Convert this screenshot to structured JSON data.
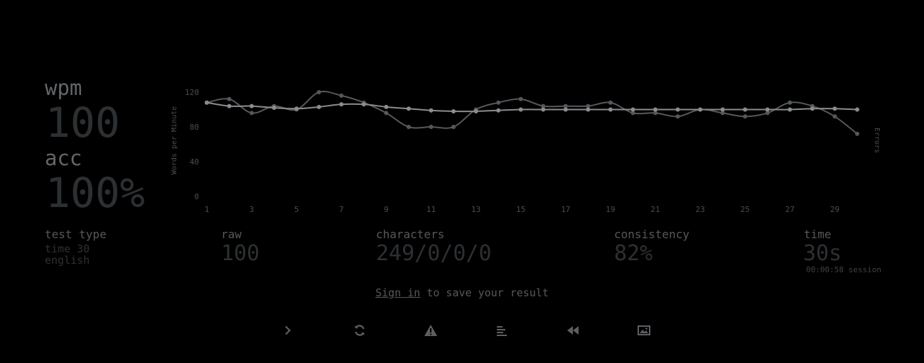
{
  "stats": {
    "wpm_label": "wpm",
    "wpm_value": "100",
    "acc_label": "acc",
    "acc_value": "100%"
  },
  "details": {
    "test_type_label": "test type",
    "test_type_mode": "time 30",
    "test_type_language": "english",
    "raw_label": "raw",
    "raw_value": "100",
    "characters_label": "characters",
    "characters_value": "249/0/0/0",
    "consistency_label": "consistency",
    "consistency_value": "82%",
    "time_label": "time",
    "time_value": "30s",
    "session_text": "00:00:58 session"
  },
  "signin": {
    "link_text": "Sign in",
    "rest_text": " to save your result"
  },
  "buttons": [
    {
      "name": "next-test-button",
      "icon": "chevron-right-icon"
    },
    {
      "name": "restart-button",
      "icon": "refresh-icon"
    },
    {
      "name": "report-button",
      "icon": "warning-icon"
    },
    {
      "name": "words-history-button",
      "icon": "align-left-icon"
    },
    {
      "name": "replay-button",
      "icon": "rewind-icon"
    },
    {
      "name": "screenshot-button",
      "icon": "image-icon"
    }
  ],
  "colors": {
    "background": "#000000",
    "wpm_line": "#8a8d90",
    "raw_line": "#55585b",
    "text_main": "#636669",
    "text_dim": "#2d3033"
  },
  "chart_data": {
    "type": "line",
    "ylabel": "Words per Minute",
    "y2label": "Errors",
    "ylim": [
      0,
      120
    ],
    "y_ticks": [
      0,
      40,
      80,
      120
    ],
    "x": [
      1,
      2,
      3,
      4,
      5,
      6,
      7,
      8,
      9,
      10,
      11,
      12,
      13,
      14,
      15,
      16,
      17,
      18,
      19,
      20,
      21,
      22,
      23,
      24,
      25,
      26,
      27,
      28,
      29,
      30
    ],
    "x_ticks": [
      1,
      3,
      5,
      7,
      9,
      11,
      13,
      15,
      17,
      19,
      21,
      23,
      25,
      27,
      29
    ],
    "series": [
      {
        "key": "wpm",
        "values": [
          108,
          104,
          104,
          102,
          101,
          103,
          106,
          106,
          103,
          101,
          99,
          98,
          98,
          99,
          100,
          100,
          100,
          100,
          100,
          100,
          100,
          100,
          100,
          100,
          100,
          100,
          100,
          101,
          101,
          100
        ]
      },
      {
        "key": "raw",
        "values": [
          108,
          112,
          96,
          104,
          100,
          120,
          116,
          108,
          96,
          80,
          80,
          80,
          100,
          108,
          112,
          104,
          104,
          104,
          108,
          96,
          96,
          92,
          100,
          96,
          92,
          96,
          108,
          104,
          92,
          72
        ]
      }
    ],
    "grid": false,
    "legend": "none"
  }
}
